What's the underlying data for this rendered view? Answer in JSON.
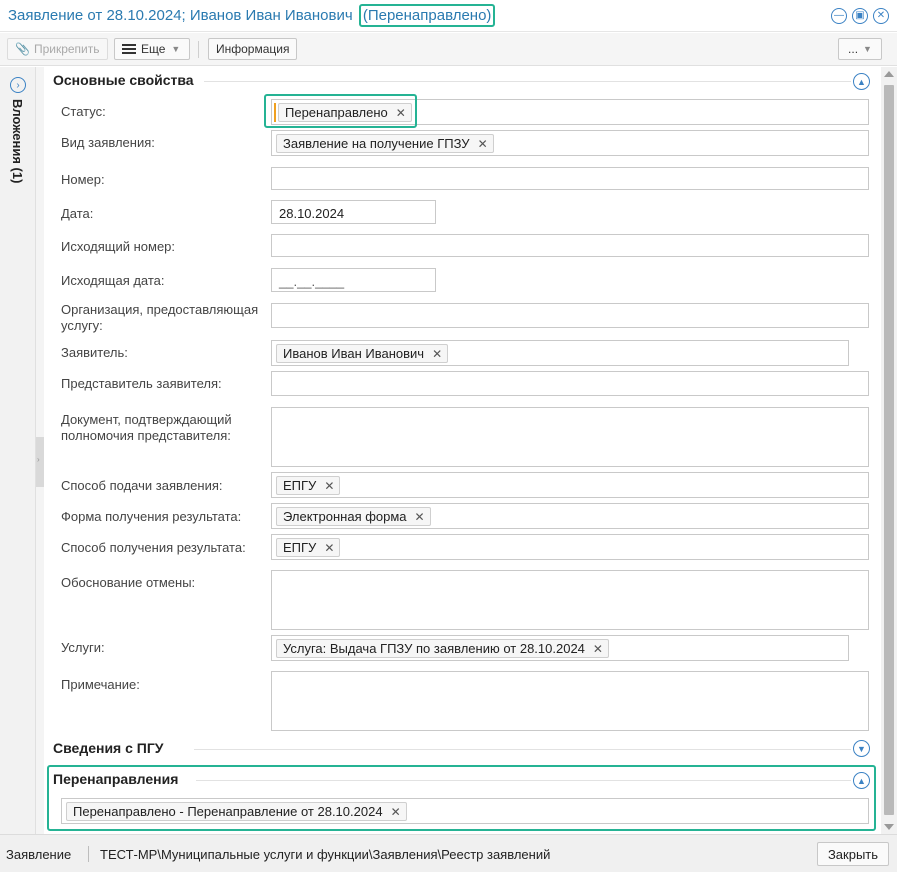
{
  "window": {
    "title": "Заявление от 28.10.2024; Иванов Иван Иванович",
    "title_status": "(Перенаправлено)",
    "icons": [
      "minimize-icon",
      "maximize-icon",
      "close-icon"
    ]
  },
  "toolbar": {
    "attach_label": "Прикрепить",
    "more_label": "Еще",
    "info_label": "Информация",
    "overflow_label": "..."
  },
  "sidetab": {
    "label": "Вложения (1)"
  },
  "sections": {
    "main_title": "Основные свойства",
    "pgu_title": "Сведения с ПГУ",
    "redirect_title": "Перенаправления"
  },
  "fields": {
    "status_label": "Статус:",
    "status_value": "Перенаправлено",
    "kind_label": "Вид заявления:",
    "kind_value": "Заявление на получение ГПЗУ",
    "number_label": "Номер:",
    "date_label": "Дата:",
    "date_value": "28.10.2024",
    "out_number_label": "Исходящий номер:",
    "out_date_label": "Исходящая дата:",
    "out_date_mask": "__.__.____",
    "org_label": "Организация, предоставляющая услугу:",
    "applicant_label": "Заявитель:",
    "applicant_value": "Иванов Иван Иванович",
    "rep_label": "Представитель заявителя:",
    "rep_doc_label": "Документ, подтверждающий полномочия представителя:",
    "submit_label": "Способ подачи заявления:",
    "submit_value": "ЕПГУ",
    "result_form_label": "Форма получения результата:",
    "result_form_value": "Электронная форма",
    "result_method_label": "Способ получения результата:",
    "result_method_value": "ЕПГУ",
    "cancel_reason_label": "Обоснование отмены:",
    "services_label": "Услуги:",
    "services_value": "Услуга: Выдача ГПЗУ по заявлению от 28.10.2024",
    "note_label": "Примечание:",
    "redirect_value": "Перенаправлено - Перенаправление от 28.10.2024"
  },
  "statusbar": {
    "left": "Заявление",
    "path": "ТЕСТ-МР\\Муниципальные услуги и функции\\Заявления\\Реестр заявлений",
    "close_label": "Закрыть"
  },
  "colors": {
    "accent": "#2a7ab0",
    "highlight": "#25b394",
    "required_mark": "#f0a020"
  }
}
